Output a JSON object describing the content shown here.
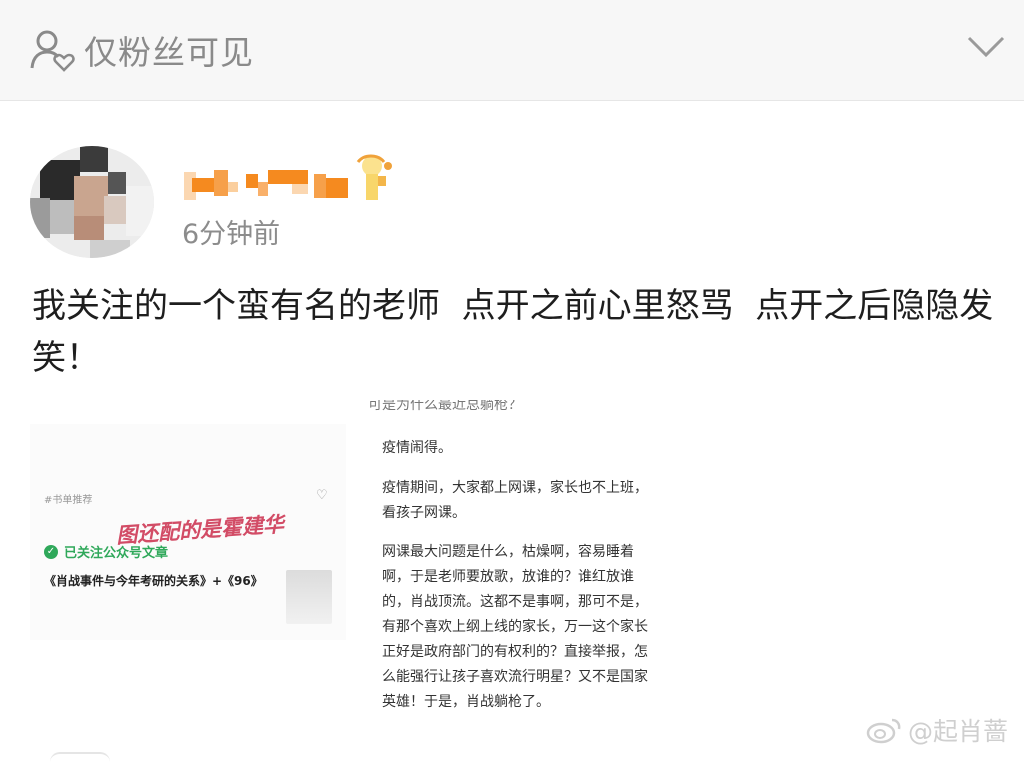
{
  "visibility": {
    "label": "仅粉丝可见",
    "icon": "fans-only-icon",
    "toggle_icon": "chevron-down-icon"
  },
  "post": {
    "author_avatar": "avatar",
    "author_name_icon": "pixelated-username",
    "badge_icon": "vip-badge-icon",
    "timestamp": "6分钟前",
    "text": "我关注的一个蛮有名的老师  点开之前心里怒骂  点开之后隐隐发笑！"
  },
  "left_image": {
    "header": "#书单推荐",
    "heart_icon": "heart-icon",
    "handwritten_note": "图还配的是霍建华",
    "followed_label": "已关注公众号文章",
    "article_title": "《肖战事件与今年考研的关系》+《96》"
  },
  "right_image": {
    "cut_top": "可是为什么最近总躺枪？",
    "para1": "疫情闹得。",
    "para2": "疫情期间，大家都上网课，家长也不上班，看孩子网课。",
    "para3": "网课最大问题是什么，枯燥啊，容易睡着啊，于是老师要放歌，放谁的？谁红放谁的，肖战顶流。这都不是事啊，那可不是，有那个喜欢上纲上线的家长，万一这个家长正好是政府部门的有权利的？直接举报，怎么能强行让孩子喜欢流行明星？又不是国家英雄！于是，肖战躺枪了。"
  },
  "watermark": {
    "text": "@起肖蔷",
    "icon": "weibo-logo-icon"
  },
  "colors": {
    "accent_orange": "#f5871f",
    "follow_green": "#2fa85a",
    "note_pink": "#d24c66"
  }
}
